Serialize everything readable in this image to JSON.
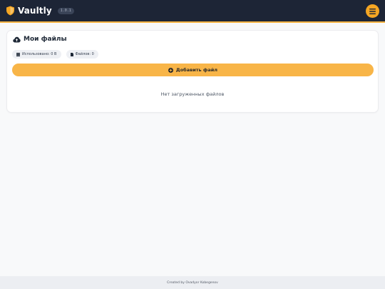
{
  "header": {
    "app_name": "Vaultly",
    "version": "1.0.1",
    "logo_icon": "shield-icon",
    "menu_icon": "hamburger-menu-icon"
  },
  "files_panel": {
    "title": "Мои файлы",
    "title_icon": "cloud-upload-icon",
    "stats": {
      "used_label": "Использовано: 0 B",
      "files_label": "Файлов: 0"
    },
    "add_button_label": "Добавить файл",
    "empty_message": "Нет загруженных файлов"
  },
  "footer": {
    "credit": "Created by Ovadyor Kobegenov"
  },
  "colors": {
    "header_bg": "#1d2536",
    "accent": "#f5a623",
    "button_bg": "#f8b548",
    "page_bg": "#f8f9fa"
  }
}
